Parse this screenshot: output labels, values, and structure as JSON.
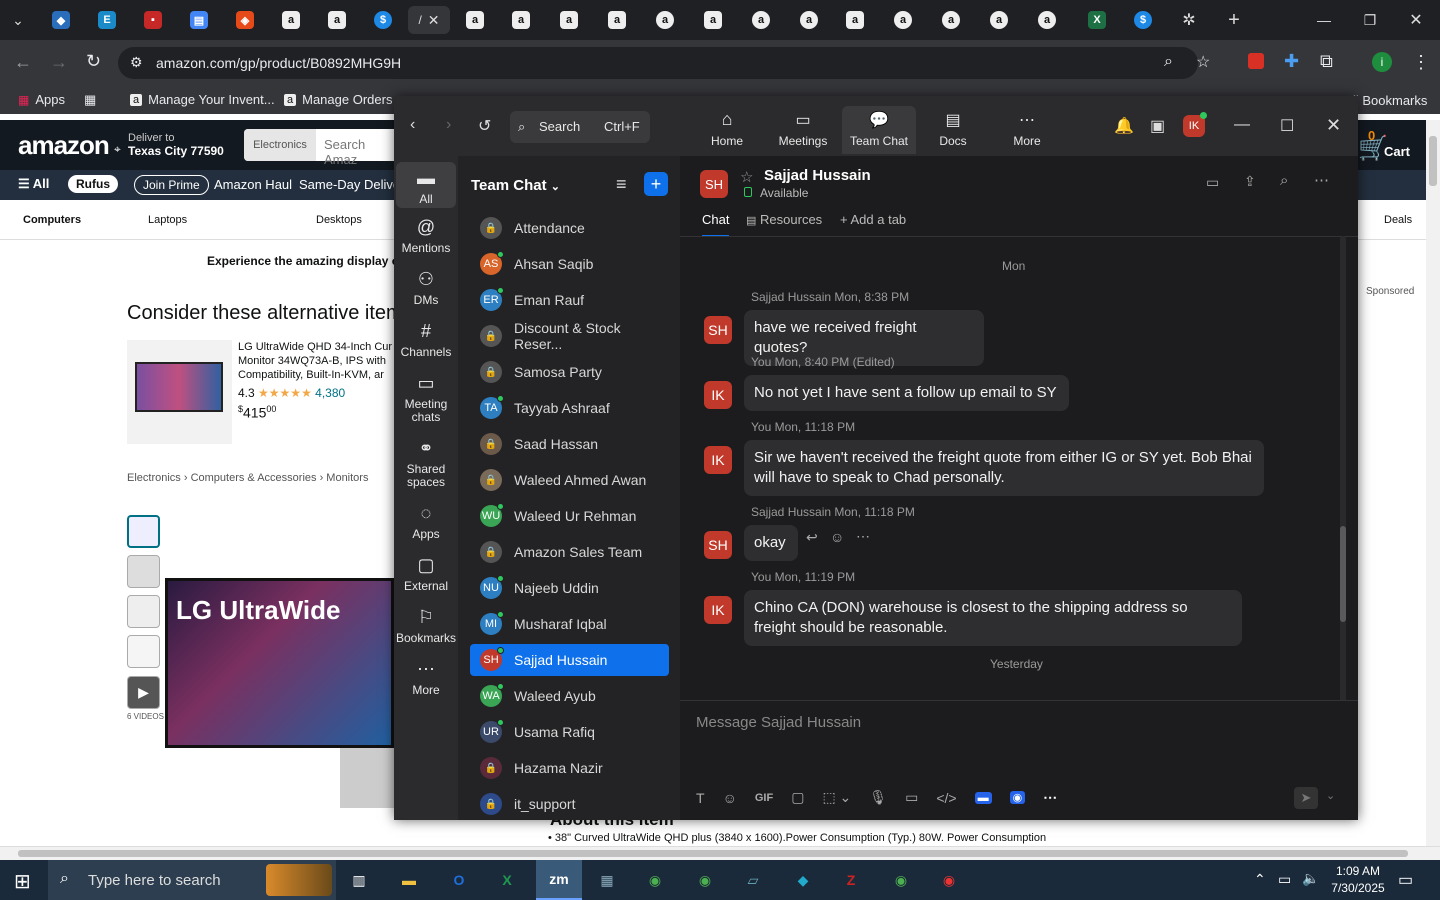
{
  "browser": {
    "url": "amazon.com/gp/product/B0892MHG9H",
    "bookmarks": [
      "Apps",
      "Manage Your Invent...",
      "Manage Orders",
      "All Bookmarks"
    ]
  },
  "amazon": {
    "logo": "amazon",
    "deliver_to": "Deliver to",
    "location": "Texas City 77590",
    "search_category": "Electronics",
    "search_placeholder": "Search Amaz",
    "cart_count": "0",
    "cart_label": "Cart",
    "nav": [
      "All",
      "Rufus",
      "Join Prime",
      "Amazon Haul",
      "Same-Day Delivery"
    ],
    "subnav": [
      "Computers",
      "Laptops",
      "Desktops",
      "Deals"
    ],
    "banner": "Experience the amazing display of L",
    "sponsored": "Sponsored",
    "alt_heading": "Consider these alternative item",
    "product_title": "LG UltraWide QHD 34-Inch Cur Monitor 34WQ73A-B, IPS with Compatibility, Built-In-KVM, ar",
    "rating": "4.3",
    "rating_count": "4,380",
    "price_dollars": "415",
    "price_cents": "00",
    "breadcrumb": "Electronics › Computers & Accessories › Monitors",
    "videos": "6 VIDEOS",
    "hero_text": "LG UltraWide",
    "about_item": "About this item",
    "bullet": "38\" Curved UltraWide QHD plus (3840 x 1600).Power Consumption (Typ.) 80W. Power Consumption"
  },
  "zoom": {
    "search_label": "Search",
    "search_shortcut": "Ctrl+F",
    "tabs": [
      "Home",
      "Meetings",
      "Team Chat",
      "Docs",
      "More"
    ],
    "profile_initials": "IK",
    "rail": [
      "All",
      "Mentions",
      "DMs",
      "Channels",
      "Meeting chats",
      "Shared spaces",
      "Apps",
      "External",
      "Bookmarks",
      "More"
    ],
    "list_title": "Team Chat",
    "contacts": [
      {
        "name": "Attendance",
        "initials": "",
        "color": "#555"
      },
      {
        "name": "Ahsan Saqib",
        "initials": "AS",
        "color": "#d9652b"
      },
      {
        "name": "Eman Rauf",
        "initials": "ER",
        "color": "#2d7fc1"
      },
      {
        "name": "Discount & Stock Reser...",
        "initials": "",
        "color": "#555"
      },
      {
        "name": "Samosa Party",
        "initials": "",
        "color": "#555"
      },
      {
        "name": "Tayyab Ashraaf",
        "initials": "TA",
        "color": "#2d7fc1"
      },
      {
        "name": "Saad Hassan",
        "initials": "",
        "color": "#6b5a4a"
      },
      {
        "name": "Waleed Ahmed Awan",
        "initials": "",
        "color": "#7a6a5a"
      },
      {
        "name": "Waleed Ur Rehman",
        "initials": "WU",
        "color": "#3aa655"
      },
      {
        "name": "Amazon Sales Team",
        "initials": "",
        "color": "#555"
      },
      {
        "name": "Najeeb Uddin",
        "initials": "NU",
        "color": "#2d7fc1"
      },
      {
        "name": "Musharaf Iqbal",
        "initials": "MI",
        "color": "#2d7fc1"
      },
      {
        "name": "Sajjad Hussain",
        "initials": "SH",
        "color": "#c0392b"
      },
      {
        "name": "Waleed Ayub",
        "initials": "WA",
        "color": "#3aa655"
      },
      {
        "name": "Usama Rafiq",
        "initials": "UR",
        "color": "#3b4a6b"
      },
      {
        "name": "Hazama Nazir",
        "initials": "",
        "color": "#5a2a3a"
      },
      {
        "name": "it_support",
        "initials": "",
        "color": "#2d4a8a"
      }
    ],
    "chat_header": {
      "initials": "SH",
      "name": "Sajjad Hussain",
      "status": "Available"
    },
    "chat_tabs": [
      "Chat",
      "Resources",
      "Add a tab"
    ],
    "day_mon": "Mon",
    "day_yesterday": "Yesterday",
    "messages": [
      {
        "initials": "SH",
        "meta": "Sajjad Hussain  Mon, 8:38 PM",
        "text": "have we received freight quotes?"
      },
      {
        "initials": "IK",
        "meta": "You  Mon, 8:40 PM (Edited)",
        "text": "No not yet I have sent a follow up email to SY"
      },
      {
        "initials": "IK",
        "meta": "You  Mon, 11:18 PM",
        "text": "Sir we haven't received the freight quote from either IG or SY yet. Bob Bhai will have to speak to Chad personally."
      },
      {
        "initials": "SH",
        "meta": "Sajjad Hussain  Mon, 11:18 PM",
        "text": "okay"
      },
      {
        "initials": "IK",
        "meta": "You  Mon, 11:19 PM",
        "text": "Chino CA (DON) warehouse is closest to the shipping address  so freight should be reasonable."
      }
    ],
    "composer_placeholder": "Message Sajjad Hussain"
  },
  "taskbar": {
    "search_placeholder": "Type here to search",
    "time": "1:09 AM",
    "date": "7/30/2025"
  }
}
